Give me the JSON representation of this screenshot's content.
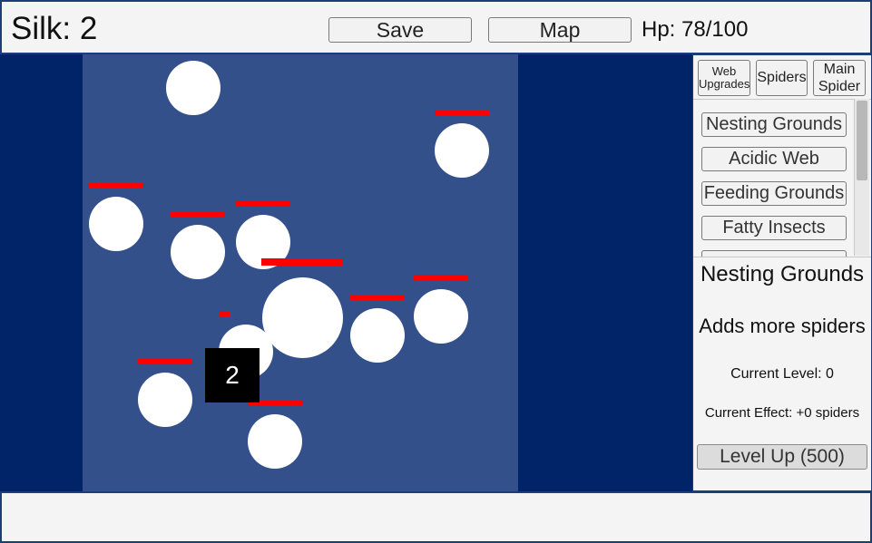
{
  "header": {
    "silk_label": "Silk: 2",
    "save_label": "Save",
    "map_label": "Map",
    "hp_label": "Hp: 78/100"
  },
  "game": {
    "counter_value": "2"
  },
  "sidebar": {
    "tabs": [
      {
        "label": "Web Upgrades"
      },
      {
        "label": "Spiders"
      },
      {
        "label": "Main Spider"
      }
    ],
    "upgrades": [
      {
        "label": "Nesting Grounds"
      },
      {
        "label": "Acidic Web"
      },
      {
        "label": "Feeding Grounds"
      },
      {
        "label": "Fatty Insects"
      }
    ],
    "detail": {
      "title": "Nesting Grounds",
      "description": "Adds more spiders",
      "current_level": "Current Level: 0",
      "current_effect": "Current Effect: +0 spiders",
      "level_up_label": "Level Up (500)"
    }
  },
  "colors": {
    "background": "#012469",
    "arena": "#34508a",
    "enemy": "#ffffff",
    "health_bar": "#ff0000",
    "panel": "#f4f4f4"
  }
}
